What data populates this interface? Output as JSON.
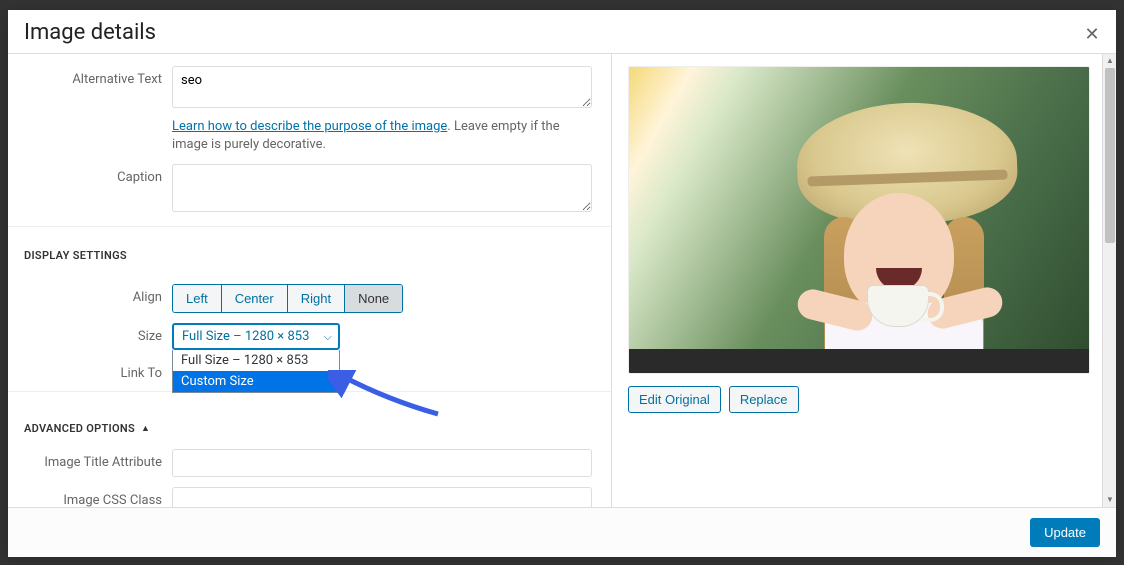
{
  "modal": {
    "title": "Image details",
    "close_aria": "Close"
  },
  "alt": {
    "label": "Alternative Text",
    "value": "seo",
    "help_link": "Learn how to describe the purpose of the image",
    "help_tail": ". Leave empty if the image is purely decorative."
  },
  "caption": {
    "label": "Caption",
    "value": ""
  },
  "display": {
    "heading": "DISPLAY SETTINGS",
    "align_label": "Align",
    "align": {
      "left": "Left",
      "center": "Center",
      "right": "Right",
      "none": "None",
      "selected": "none"
    },
    "size_label": "Size",
    "size_selected": "Full Size – 1280 × 853",
    "size_options": [
      "Full Size – 1280 × 853",
      "Custom Size"
    ],
    "size_highlighted": "Custom Size",
    "linkto_label": "Link To"
  },
  "advanced": {
    "heading": "ADVANCED OPTIONS",
    "expanded": true,
    "title_attr_label": "Image Title Attribute",
    "title_attr_value": "",
    "css_class_label": "Image CSS Class",
    "css_class_value": ""
  },
  "preview": {
    "edit_label": "Edit Original",
    "replace_label": "Replace"
  },
  "footer": {
    "update": "Update"
  }
}
